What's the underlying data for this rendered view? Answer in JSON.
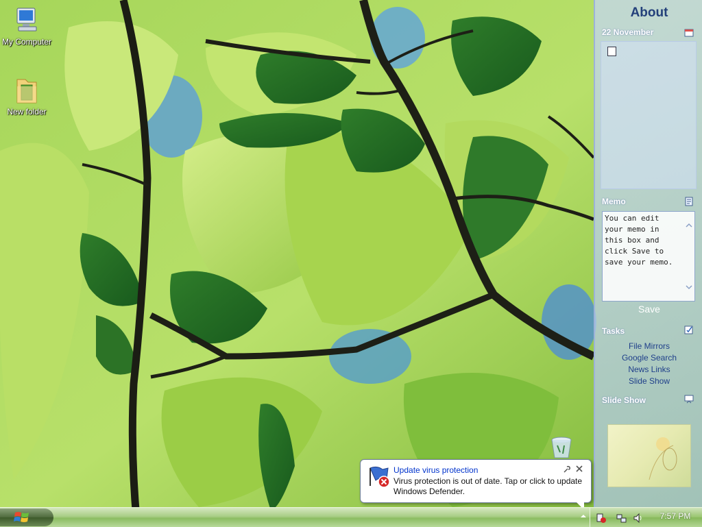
{
  "desktop": {
    "icons": [
      {
        "label": "My Computer",
        "icon": "computer-icon"
      },
      {
        "label": "New folder",
        "icon": "folder-icon"
      }
    ],
    "recycle_bin_icon": "recycle-bin-icon"
  },
  "sidebar": {
    "title": "About",
    "calendar": {
      "header": "22 November",
      "icon": "calendar-icon"
    },
    "memo": {
      "header": "Memo",
      "text": "You can edit your memo in this box and click Save to save your memo.",
      "save_label": "Save"
    },
    "tasks": {
      "header": "Tasks",
      "items": [
        "File Mirrors",
        "Google Search",
        "News Links",
        "Slide Show"
      ]
    },
    "slideshow": {
      "header": "Slide Show"
    }
  },
  "balloon": {
    "title": "Update virus protection",
    "body": "Virus protection is out of date. Tap or click to update Windows Defender."
  },
  "taskbar": {
    "clock": "7:57 PM"
  },
  "colors": {
    "sidebar_title": "#23407a",
    "balloon_title": "#0033cc",
    "taskbar_green": "#8cbd62",
    "link_blue": "#1f3f8a"
  }
}
